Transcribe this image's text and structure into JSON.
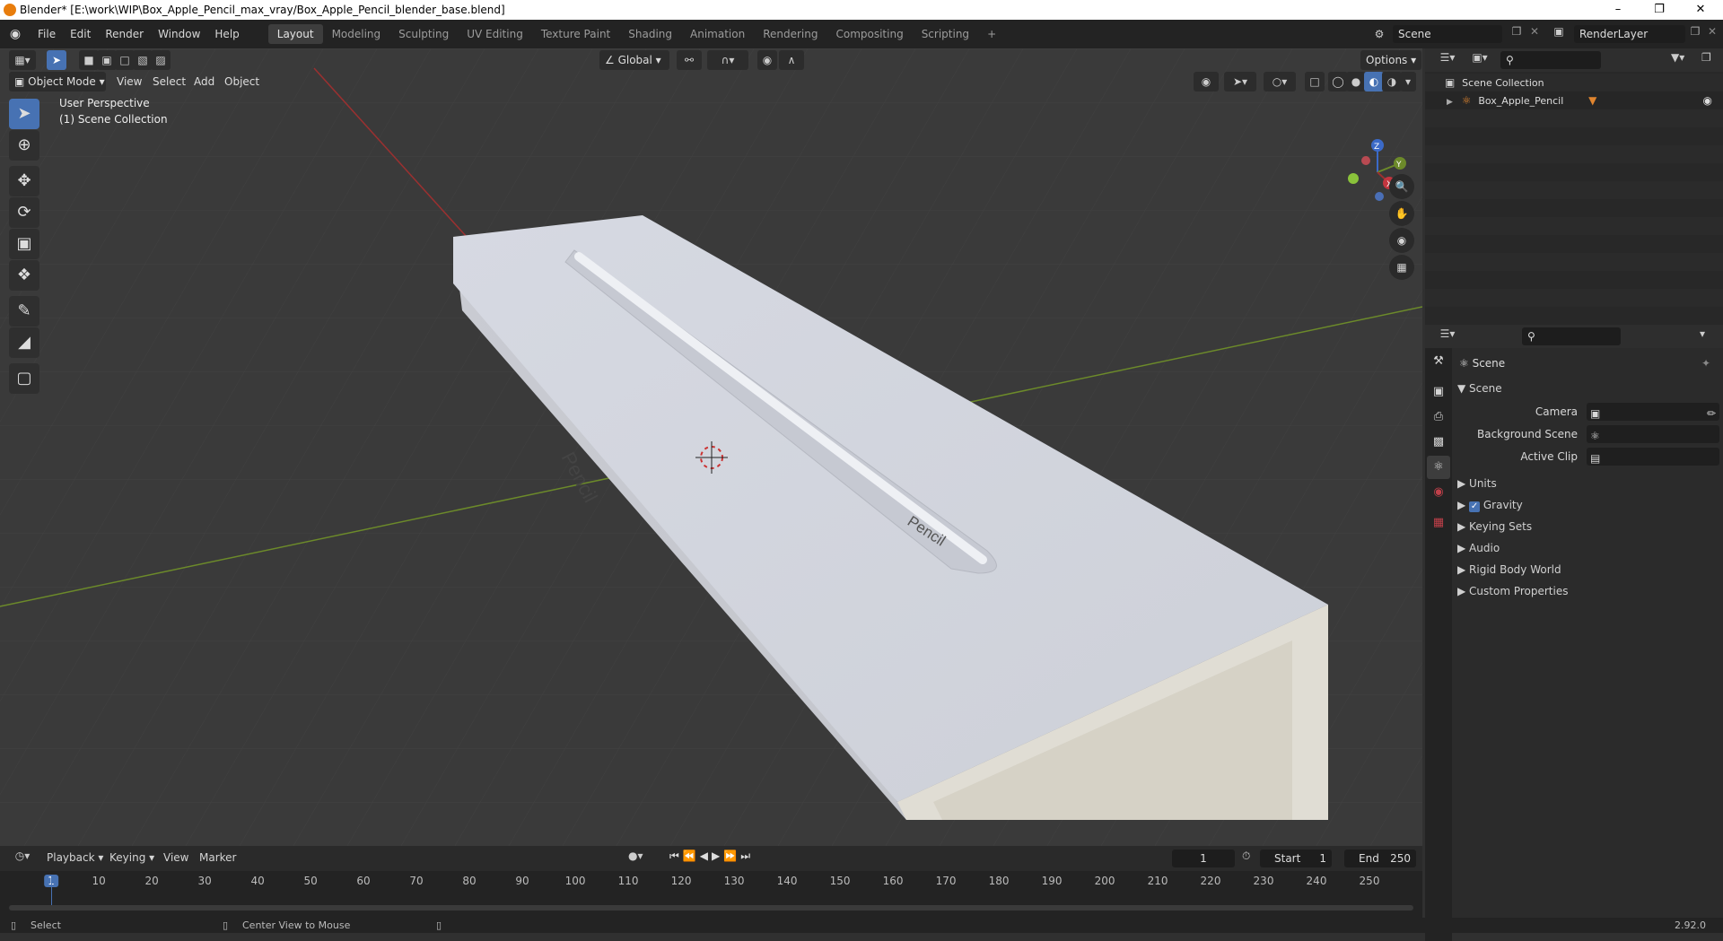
{
  "window": {
    "title": "Blender* [E:\\work\\WIP\\Box_Apple_Pencil_max_vray/Box_Apple_Pencil_blender_base.blend]"
  },
  "menus": [
    "File",
    "Edit",
    "Render",
    "Window",
    "Help"
  ],
  "workspaces": [
    "Layout",
    "Modeling",
    "Sculpting",
    "UV Editing",
    "Texture Paint",
    "Shading",
    "Animation",
    "Rendering",
    "Compositing",
    "Scripting"
  ],
  "scene": {
    "name": "Scene",
    "view_layer": "RenderLayer"
  },
  "viewport": {
    "mode": "Object Mode",
    "menu": [
      "View",
      "Select",
      "Add",
      "Object"
    ],
    "transform_orientation": "Global",
    "options_label": "Options",
    "overlay_line1": "User Perspective",
    "overlay_line2": "(1) Scene Collection",
    "gizmo_axes": [
      "Z",
      "Y",
      "X"
    ],
    "box_text": "Pencil",
    "pencil_text": "Pencil"
  },
  "outliner": {
    "root": "Scene Collection",
    "items": [
      "Box_Apple_Pencil"
    ]
  },
  "properties": {
    "header": "Scene",
    "panel_scene": "Scene",
    "fields": {
      "camera": "Camera",
      "background": "Background Scene",
      "clip": "Active Clip"
    },
    "panels": [
      "Units",
      "Gravity",
      "Keying Sets",
      "Audio",
      "Rigid Body World",
      "Custom Properties"
    ]
  },
  "timeline": {
    "menus": [
      "Playback",
      "Keying",
      "View",
      "Marker"
    ],
    "current_frame": "1",
    "start_label": "Start",
    "start": "1",
    "end_label": "End",
    "end": "250",
    "ticks": [
      "1",
      "10",
      "20",
      "30",
      "40",
      "50",
      "60",
      "70",
      "80",
      "90",
      "100",
      "110",
      "120",
      "130",
      "140",
      "150",
      "160",
      "170",
      "180",
      "190",
      "200",
      "210",
      "220",
      "230",
      "240",
      "250"
    ]
  },
  "status": {
    "left": "Select",
    "middle": "Center View to Mouse",
    "version": "2.92.0"
  },
  "colors": {
    "accent": "#4772b3",
    "xaxis": "#9b3030",
    "yaxis": "#6c8a2a",
    "zaxis": "#3b6ac8"
  }
}
